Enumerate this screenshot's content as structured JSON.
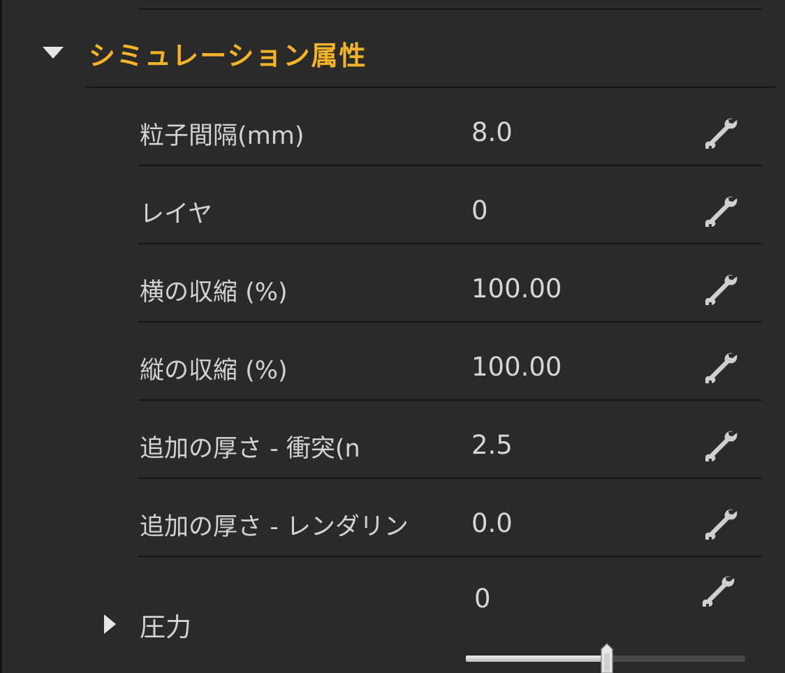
{
  "section": {
    "title": "シミュレーション属性",
    "expanded": true,
    "accent_color": "#f3b42a"
  },
  "rows": [
    {
      "label": "粒子間隔(mm)",
      "value": "8.0",
      "icon": "wrench-icon"
    },
    {
      "label": "レイヤ",
      "value": "0",
      "icon": "wrench-icon"
    },
    {
      "label": "横の収縮 (%)",
      "value": "100.00",
      "icon": "wrench-icon"
    },
    {
      "label": "縦の収縮 (%)",
      "value": "100.00",
      "icon": "wrench-icon"
    },
    {
      "label": "追加の厚さ - 衝突(n",
      "value": "2.5",
      "icon": "wrench-icon"
    },
    {
      "label": "追加の厚さ - レンダリン",
      "value": "0.0",
      "icon": "wrench-icon"
    }
  ],
  "pressure": {
    "label": "圧力",
    "value": "0",
    "expanded": false,
    "icon": "wrench-icon",
    "slider_fraction": 0.505
  }
}
